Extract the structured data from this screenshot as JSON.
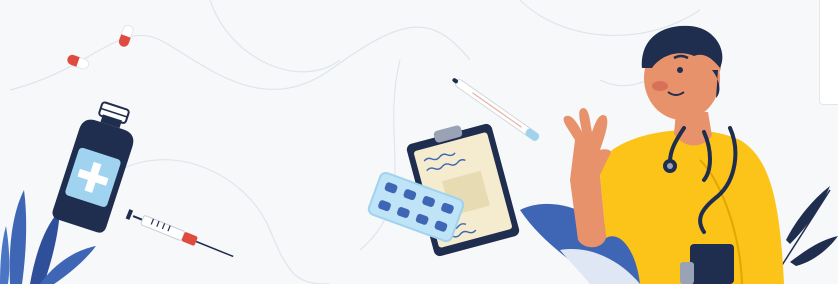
{
  "banner": {
    "theme": "medical-healthcare-illustration",
    "colors": {
      "background": "#f7f8f9",
      "navy": "#1f2d4f",
      "blue": "#3f66b5",
      "light_blue": "#9fd3ef",
      "yellow": "#fcc419",
      "skin": "#e8926b",
      "red": "#e04a3f"
    },
    "icons": [
      "pill-capsule-icon",
      "medicine-bottle-icon",
      "syringe-icon",
      "thermometer-icon",
      "clipboard-icon",
      "blister-pack-icon",
      "stethoscope-icon",
      "doctor-figure",
      "leaf-plant-icon"
    ]
  }
}
